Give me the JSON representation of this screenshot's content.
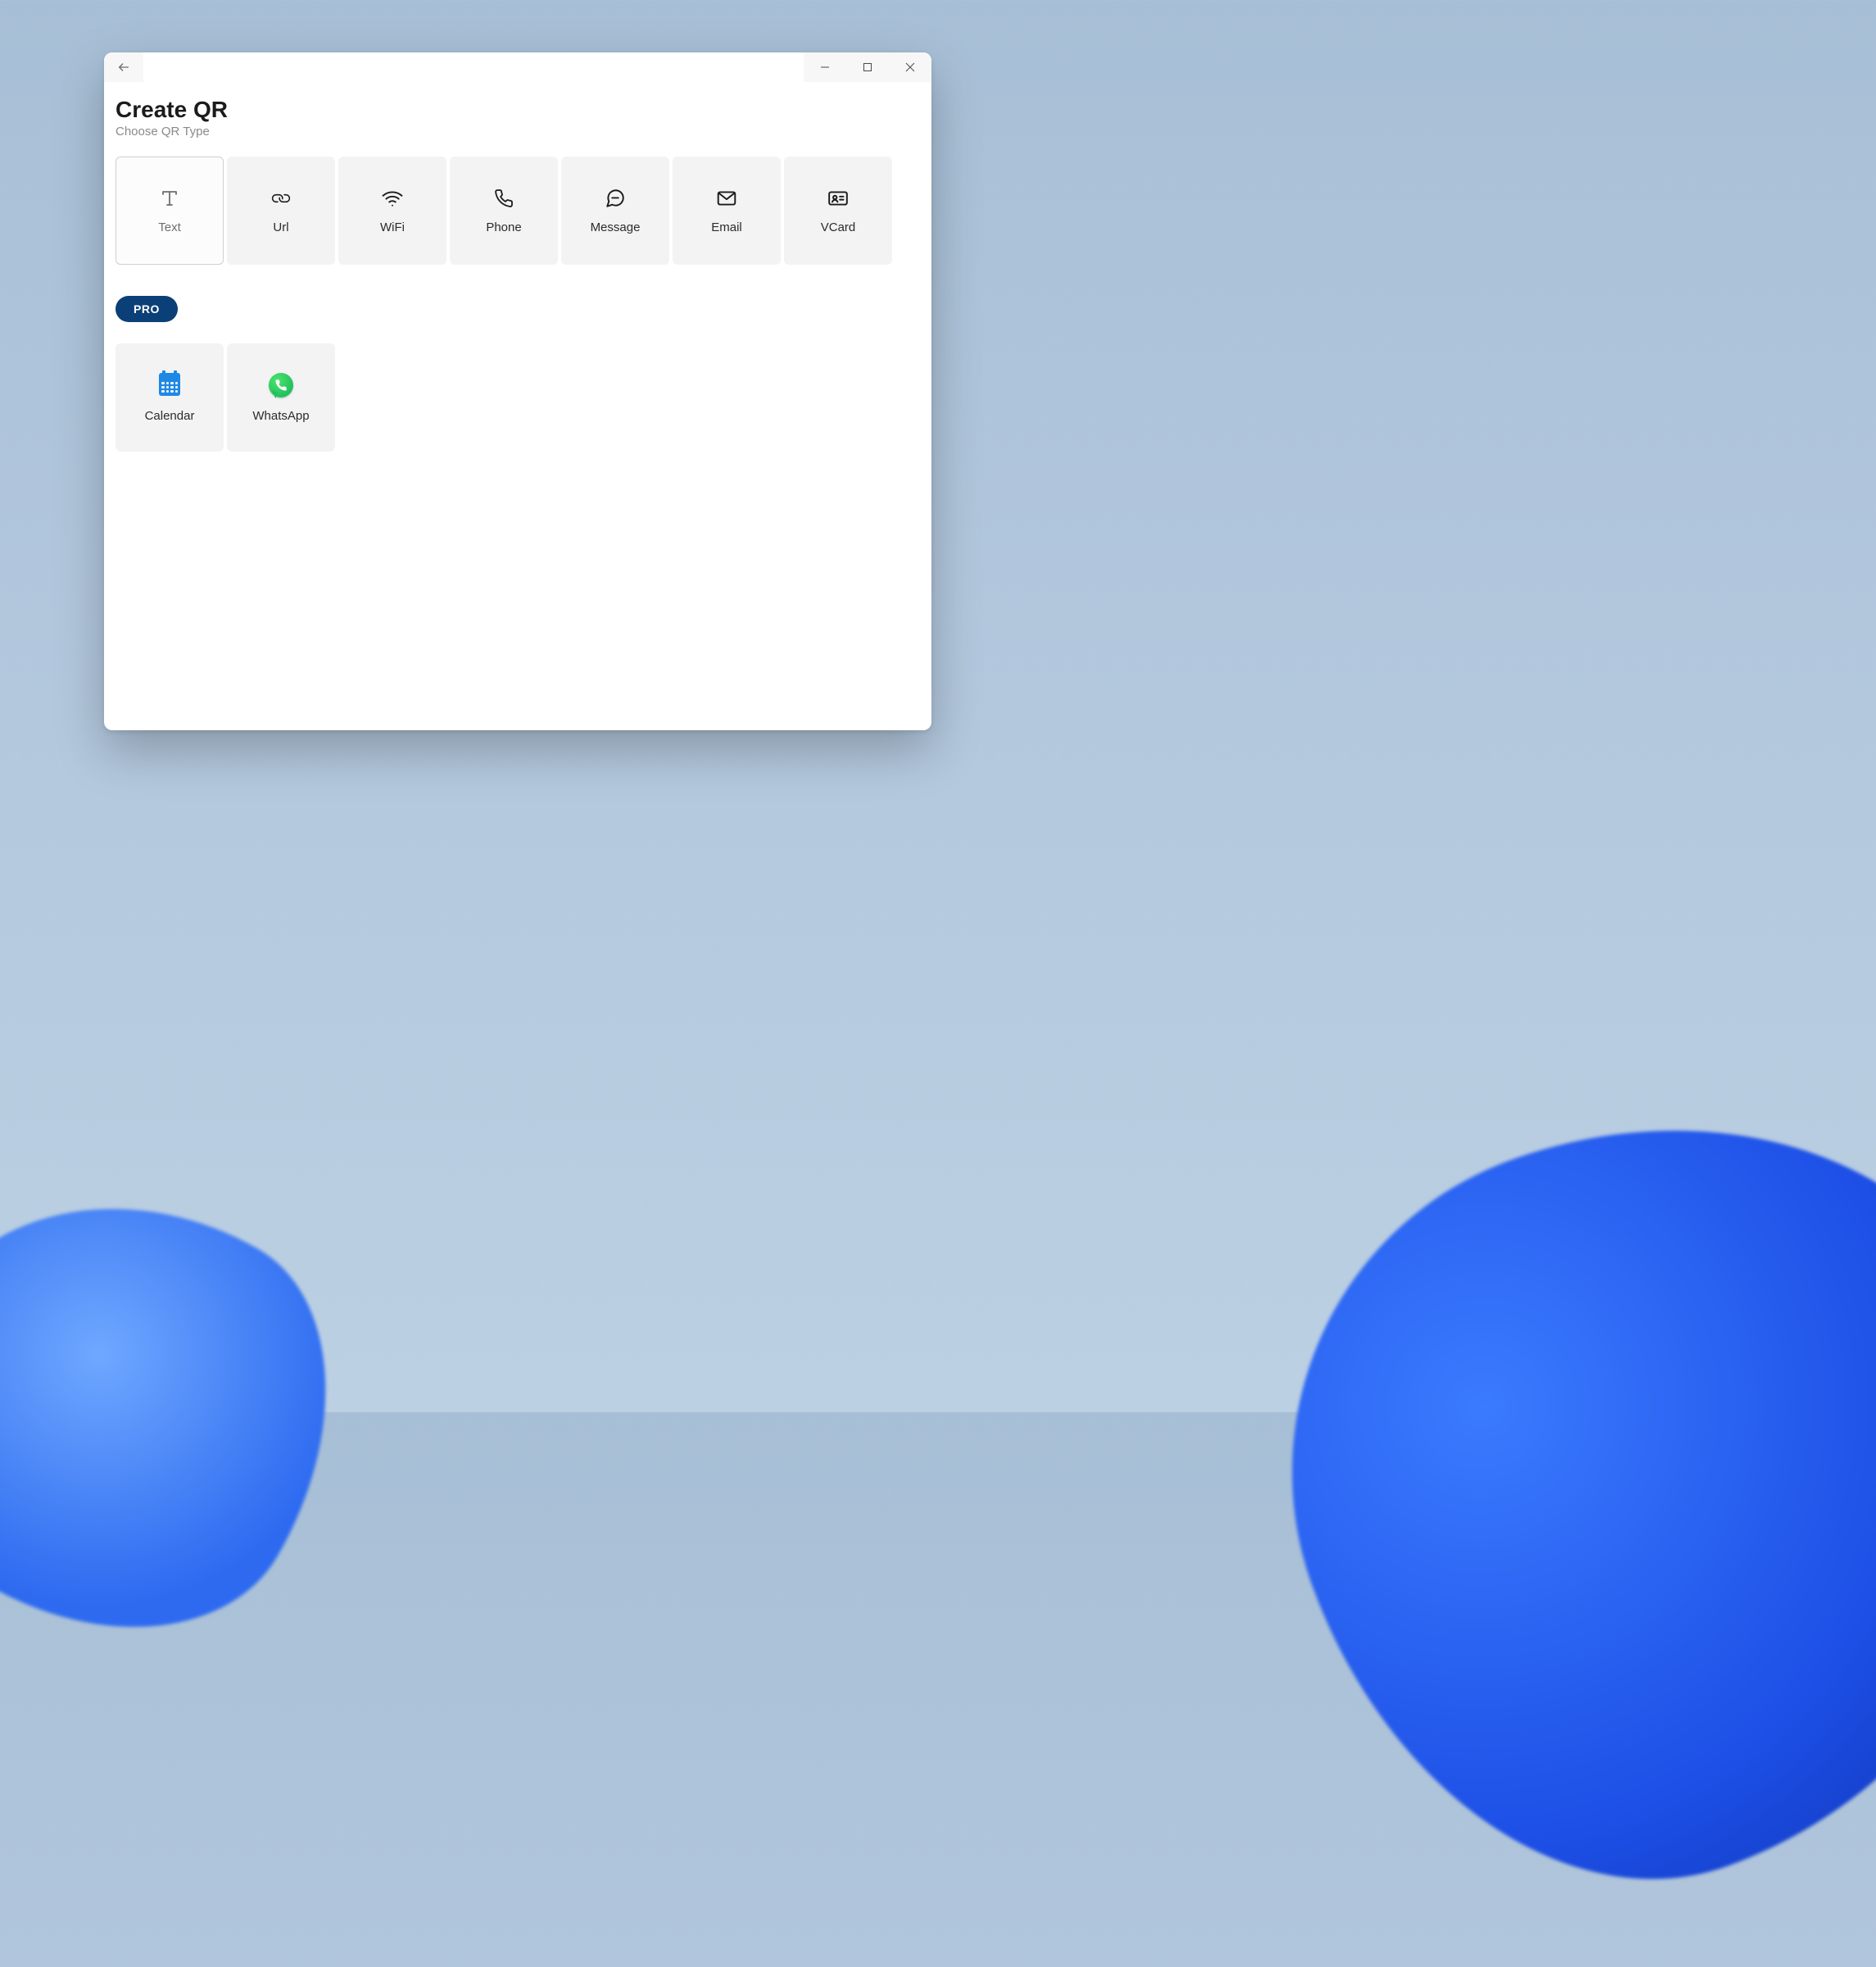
{
  "header": {
    "title": "Create QR",
    "subtitle": "Choose QR Type"
  },
  "qr_types": [
    {
      "id": "text",
      "label": "Text",
      "icon": "text-icon",
      "selected": true
    },
    {
      "id": "url",
      "label": "Url",
      "icon": "link-icon",
      "selected": false
    },
    {
      "id": "wifi",
      "label": "WiFi",
      "icon": "wifi-icon",
      "selected": false
    },
    {
      "id": "phone",
      "label": "Phone",
      "icon": "phone-icon",
      "selected": false
    },
    {
      "id": "message",
      "label": "Message",
      "icon": "message-icon",
      "selected": false
    },
    {
      "id": "email",
      "label": "Email",
      "icon": "mail-icon",
      "selected": false
    },
    {
      "id": "vcard",
      "label": "VCard",
      "icon": "vcard-icon",
      "selected": false
    }
  ],
  "pro": {
    "badge_label": "PRO"
  },
  "pro_types": [
    {
      "id": "calendar",
      "label": "Calendar",
      "icon": "calendar-icon"
    },
    {
      "id": "whatsapp",
      "label": "WhatsApp",
      "icon": "whatsapp-icon"
    }
  ],
  "colors": {
    "accent": "#0b3f77",
    "calendar_blue": "#1e88e5",
    "whatsapp_green": "#22c15e"
  }
}
